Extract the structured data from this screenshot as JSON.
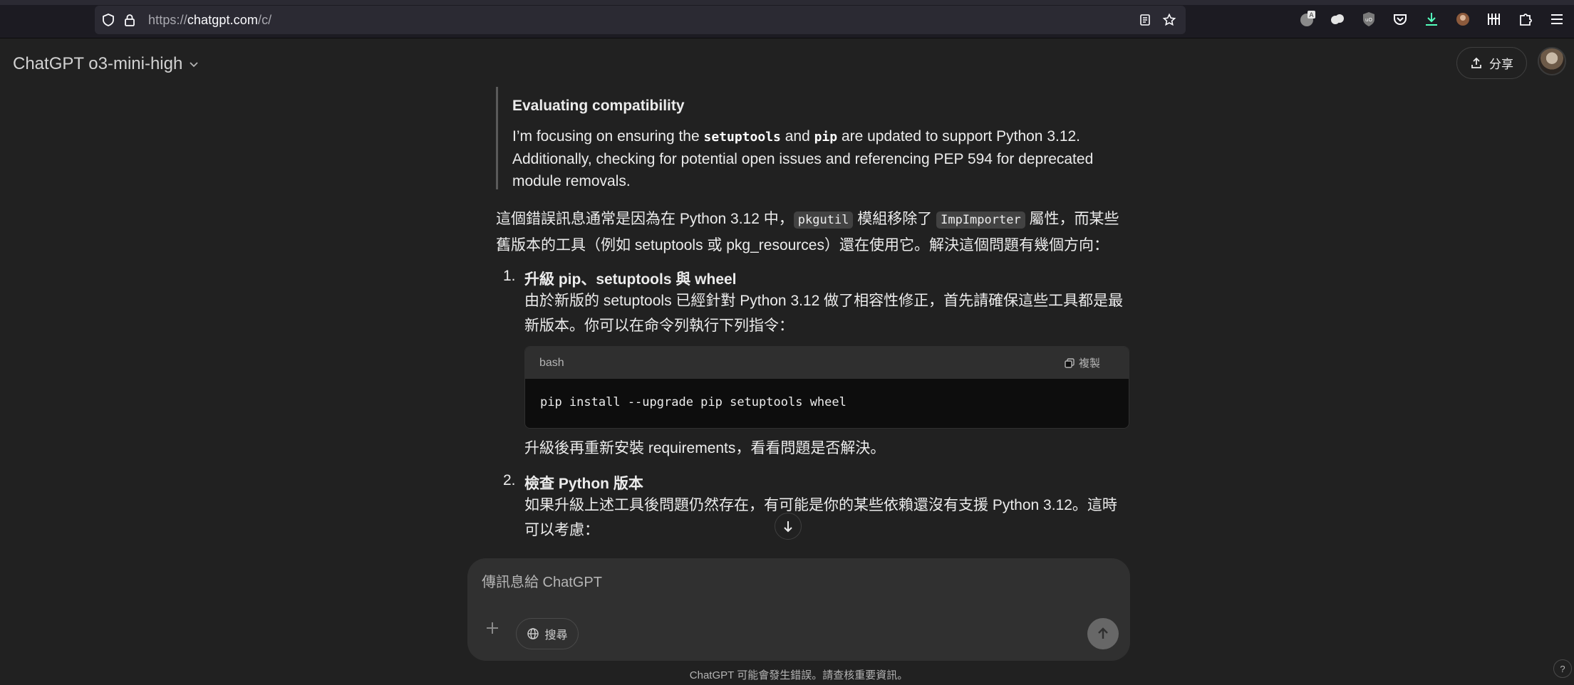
{
  "browser": {
    "url_prefix": "https://",
    "url_host": "chatgpt.com",
    "url_path": "/c/",
    "icons": [
      "shield-icon",
      "lock-icon",
      "reader-view-icon",
      "bookmark-star-icon"
    ],
    "extensions": [
      "translate-icon",
      "extension-cloud-icon",
      "ublock-icon",
      "pocket-icon",
      "downloads-icon",
      "profile-extension-icon",
      "library-icon",
      "extensions-puzzle-icon",
      "menu-icon"
    ]
  },
  "header": {
    "model_label": "ChatGPT o3-mini-high",
    "share_label": "分享"
  },
  "reasoning": {
    "title": "Evaluating compatibility",
    "text_1": "I’m focusing on ensuring the ",
    "code_1": "setuptools",
    "text_2": " and ",
    "code_2": "pip",
    "text_3": " are updated to support Python 3.12. Additionally, checking for potential open issues and referencing PEP 594 for deprecated module removals."
  },
  "answer": {
    "intro_1": "這個錯誤訊息通常是因為在 Python 3.12 中，",
    "intro_code_1": "pkgutil",
    "intro_2": " 模組移除了 ",
    "intro_code_2": "ImpImporter",
    "intro_3": " 屬性，而某些舊版本的工具（例如 setuptools 或 pkg_resources）還在使用它。解決這個問題有幾個方向：",
    "items": [
      {
        "num": "1.",
        "title": "升級 pip、setuptools 與 wheel",
        "body": "由於新版的 setuptools 已經針對 Python 3.12 做了相容性修正，首先請確保這些工具都是最新版本。你可以在命令列執行下列指令：",
        "after": "升級後再重新安裝 requirements，看看問題是否解決。"
      },
      {
        "num": "2.",
        "title": "檢查 Python 版本",
        "body": "如果升級上述工具後問題仍然存在，有可能是你的某些依賴還沒有支援 Python 3.12。這時可以考慮："
      }
    ],
    "code": {
      "lang": "bash",
      "copy_label": "複製",
      "content": "pip install --upgrade pip setuptools wheel"
    }
  },
  "composer": {
    "placeholder": "傳訊息給 ChatGPT",
    "search_label": "搜尋"
  },
  "footer": {
    "disclaimer": "ChatGPT 可能會發生錯誤。請查核重要資訊。",
    "help": "?"
  }
}
